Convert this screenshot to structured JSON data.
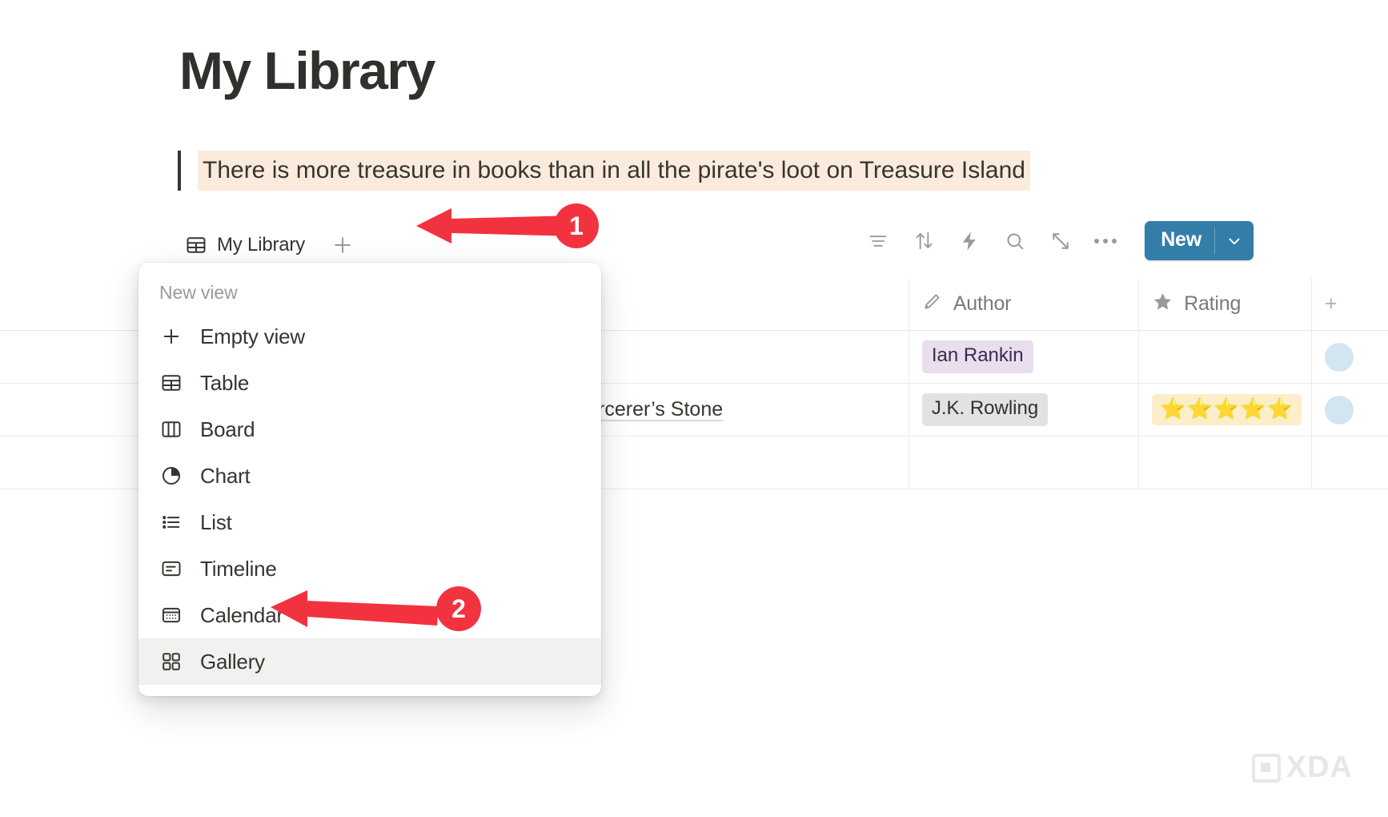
{
  "page": {
    "title": "My Library",
    "quote": "There is more treasure in books than in all the pirate's loot on Treasure Island"
  },
  "viewbar": {
    "current_view": {
      "label": "My Library",
      "icon": "table-icon"
    },
    "add_view_icon": "plus-icon"
  },
  "toolbar": {
    "icons": [
      {
        "name": "filter-icon",
        "tooltip": "Filter"
      },
      {
        "name": "sort-icon",
        "tooltip": "Sort"
      },
      {
        "name": "automation-bolt-icon",
        "tooltip": "Automations"
      },
      {
        "name": "search-icon",
        "tooltip": "Search"
      },
      {
        "name": "expand-icon",
        "tooltip": "Expand"
      },
      {
        "name": "more-options-icon",
        "tooltip": "More options"
      }
    ],
    "new_button": {
      "label": "New",
      "caret_icon": "chevron-down-icon",
      "color": "#337ea9"
    }
  },
  "menu": {
    "heading": "New view",
    "items": [
      {
        "label": "Empty view",
        "icon": "plus-icon",
        "active": false
      },
      {
        "label": "Table",
        "icon": "table-icon",
        "active": false
      },
      {
        "label": "Board",
        "icon": "board-icon",
        "active": false
      },
      {
        "label": "Chart",
        "icon": "chart-pie-icon",
        "active": false
      },
      {
        "label": "List",
        "icon": "list-icon",
        "active": false
      },
      {
        "label": "Timeline",
        "icon": "timeline-icon",
        "active": false
      },
      {
        "label": "Calendar",
        "icon": "calendar-icon",
        "active": false
      },
      {
        "label": "Gallery",
        "icon": "gallery-grid-icon",
        "active": true
      }
    ]
  },
  "table": {
    "columns": [
      {
        "label": "",
        "icon": ""
      },
      {
        "label": "Author",
        "icon": "pencil-icon"
      },
      {
        "label": "Rating",
        "icon": "star-icon"
      },
      {
        "label": "",
        "icon": "plus-icon"
      }
    ],
    "rows": [
      {
        "title": "",
        "author": "Ian Rankin",
        "author_color": "purple",
        "rating": ""
      },
      {
        "title": "nd the Sorcerer’s Stone",
        "author": "J.K. Rowling",
        "author_color": "gray",
        "rating": "⭐⭐⭐⭐⭐"
      }
    ]
  },
  "annotations": [
    {
      "number": "1",
      "target": "add-view-button"
    },
    {
      "number": "2",
      "target": "gallery-menu-item"
    }
  ],
  "watermark": {
    "text": "XDA"
  }
}
